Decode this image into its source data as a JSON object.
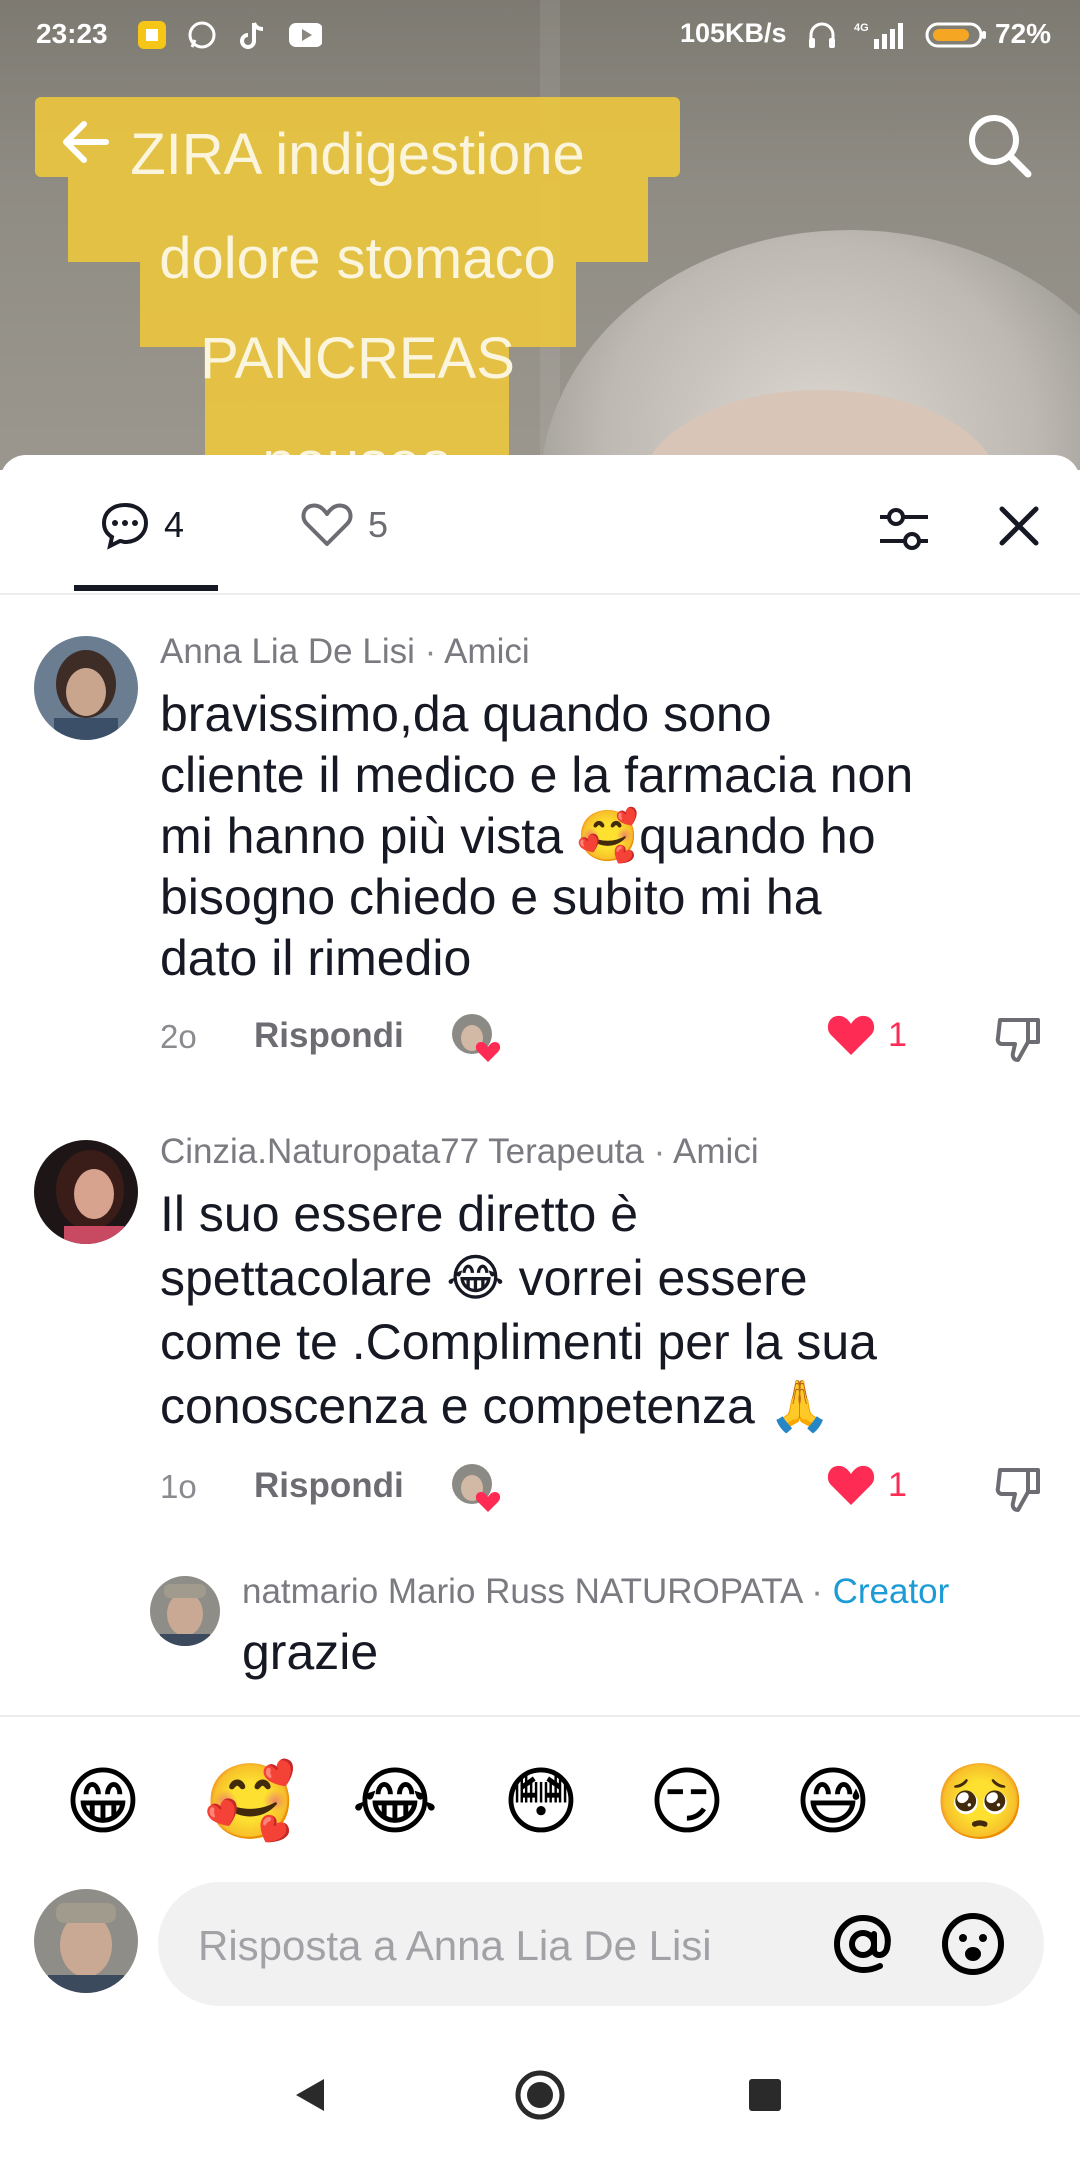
{
  "status_bar": {
    "time": "23:23",
    "network_speed": "105KB/s",
    "network_type": "4G",
    "battery_percent": "72%",
    "icons": [
      "notification-app-icon",
      "whatsapp-icon",
      "tiktok-icon",
      "youtube-icon",
      "headphones-icon",
      "signal-icon",
      "battery-icon"
    ]
  },
  "video_caption": {
    "lines": [
      "ZIRA indigestione",
      "dolore stomaco",
      "PANCREAS",
      "nausea"
    ],
    "highlight_color": "#e9c53f"
  },
  "tabs": {
    "comments_count": "4",
    "likes_count": "5"
  },
  "comments": [
    {
      "username": "Anna Lia De Lisi",
      "relation": "Amici",
      "text_lines": [
        "bravissimo,da quando sono",
        "cliente il medico e la farmacia non",
        "mi hanno più vista 🥰quando ho",
        "bisogno chiedo e subito mi ha",
        "dato il rimedio"
      ],
      "time": "2o",
      "reply_label": "Rispondi",
      "likes": "1"
    },
    {
      "username": "Cinzia.Naturopata77 Terapeuta",
      "relation": "Amici",
      "text_lines": [
        "Il suo essere diretto è",
        "spettacolare 😂 vorrei essere",
        "come te .Complimenti per la sua",
        "conoscenza e competenza 🙏"
      ],
      "time": "1o",
      "reply_label": "Rispondi",
      "likes": "1"
    },
    {
      "username": "natmario Mario Russ NATUROPATA",
      "relation": "Creator",
      "text": "grazie"
    }
  ],
  "emoji_bar": [
    "😁",
    "🥰",
    "😂",
    "😳",
    "😏",
    "😅",
    "🥺"
  ],
  "reply_box": {
    "placeholder": "Risposta a Anna Lia De Lisi"
  },
  "colors": {
    "like_red": "#fe2c55",
    "creator_blue": "#1d9bd6",
    "text_primary": "#161823",
    "text_secondary": "#7a7a80"
  }
}
